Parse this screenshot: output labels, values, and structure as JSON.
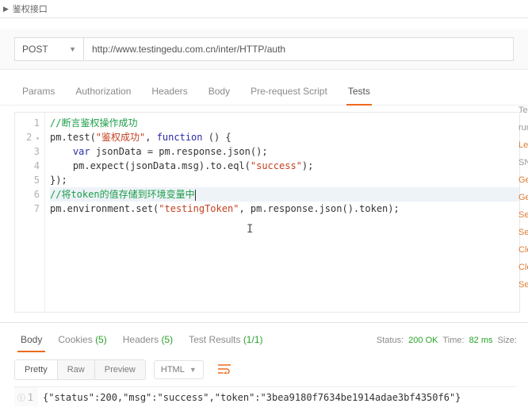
{
  "header": {
    "title": "鉴权接口"
  },
  "request": {
    "method": "POST",
    "url": "http://www.testingedu.com.cn/inter/HTTP/auth"
  },
  "tabs": {
    "params": "Params",
    "authorization": "Authorization",
    "headers": "Headers",
    "body": "Body",
    "prerequest": "Pre-request Script",
    "tests": "Tests"
  },
  "code": {
    "l1_comment": "//断言鉴权操作成功",
    "l2_a": "pm.test(",
    "l2_str": "\"鉴权成功\"",
    "l2_b": ", ",
    "l2_kw": "function",
    "l2_c": " () {",
    "l3_a": "    ",
    "l3_kw": "var",
    "l3_b": " jsonData = pm.response.json();",
    "l4": "    pm.expect(jsonData.msg).to.eql(",
    "l4_str": "\"success\"",
    "l4_b": ");",
    "l5": "});",
    "l6_comment": "//将token的值存储到环境变量中",
    "l7_a": "pm.environment.set(",
    "l7_str": "\"testingToken\"",
    "l7_b": ", pm.response.json().token);"
  },
  "right_rail": {
    "r1": "Tes",
    "r2": "rur",
    "r3": "Lea",
    "r4": "SN",
    "r5": "Ge",
    "r6": "Ge",
    "r7": "Se",
    "r8": "Se",
    "r9": "Cle",
    "r10": "Cle",
    "r11": "Se"
  },
  "response": {
    "tabs": {
      "body": "Body",
      "cookies": "Cookies",
      "cookies_count": "(5)",
      "headers": "Headers",
      "headers_count": "(5)",
      "testresults": "Test Results",
      "testresults_count": "(1/1)"
    },
    "status_label": "Status:",
    "status_value": "200 OK",
    "time_label": "Time:",
    "time_value": "82 ms",
    "size_label": "Size:"
  },
  "viewbar": {
    "pretty": "Pretty",
    "raw": "Raw",
    "preview": "Preview",
    "format": "HTML"
  },
  "resp_body": {
    "line1": "{\"status\":200,\"msg\":\"success\",\"token\":\"3bea9180f7634be1914adae3bf4350f6\"}"
  }
}
